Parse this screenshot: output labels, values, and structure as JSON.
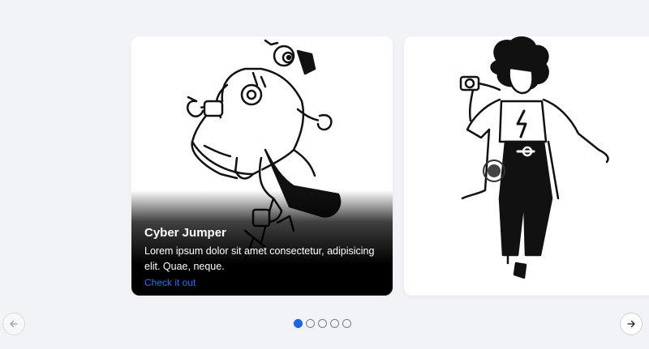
{
  "carousel": {
    "cards": [
      {
        "title": "Cyber Jumper",
        "description": "Lorem ipsum dolor sit amet consectetur, adipisicing elit. Quae, neque.",
        "link_label": "Check it out",
        "illustration": "robot-jumper-illustration"
      },
      {
        "illustration": "girl-with-camera-illustration"
      }
    ],
    "pagination": {
      "count": 5,
      "active": 1
    },
    "prev_icon": "arrow-left-icon",
    "next_icon": "arrow-right-icon"
  },
  "colors": {
    "background": "#f2f3f6",
    "accent": "#1966e8",
    "link": "#2f6ff5"
  }
}
